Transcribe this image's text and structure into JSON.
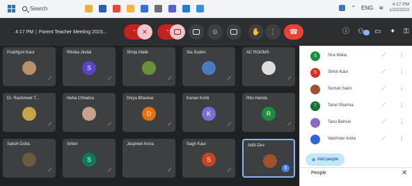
{
  "taskbar": {
    "search_label": "Search",
    "apps": [
      {
        "name": "file-explorer-icon",
        "color": "#e8b13a"
      },
      {
        "name": "word-icon",
        "color": "#2b5fb3"
      },
      {
        "name": "chrome-icon",
        "color": "#e04b3b"
      },
      {
        "name": "folder-icon",
        "color": "#f2b53a"
      },
      {
        "name": "store-icon",
        "color": "#3a6fd3"
      },
      {
        "name": "settings-icon",
        "color": "#6d6d6d"
      },
      {
        "name": "teams-icon",
        "color": "#5b5fc7"
      },
      {
        "name": "mail-icon",
        "color": "#2a79d8"
      },
      {
        "name": "photos-icon",
        "color": "#3f8bd9"
      }
    ],
    "tray": {
      "lang": "ENG",
      "time": "4:17 PM",
      "date": "1/23/2023"
    }
  },
  "meet": {
    "time": "4:17 PM",
    "title": "Parent Teacher Meeting 2023..."
  },
  "tiles": [
    {
      "name": "Prabhjyot Kaur",
      "initial": "",
      "color": "#b7916e"
    },
    {
      "name": "Ritvika Jindal",
      "initial": "S",
      "color": "#5a43c7"
    },
    {
      "name": "Shrija Malik",
      "initial": "",
      "color": "#6b8e3a"
    },
    {
      "name": "Sia Suden",
      "initial": "",
      "color": "#4a7bbf"
    },
    {
      "name": "AC ROOMS",
      "initial": "",
      "color": "#dddddd"
    },
    {
      "name": "Dr. Rashmeet T...",
      "initial": "",
      "color": "#c9a24a"
    },
    {
      "name": "Neha Chhabra",
      "initial": "",
      "color": "#c9a08c"
    },
    {
      "name": "Divya Bhaskar",
      "initial": "D",
      "color": "#e8710a"
    },
    {
      "name": "Kanan Kohli",
      "initial": "K",
      "color": "#7b6fd6"
    },
    {
      "name": "Ritu Handa",
      "initial": "R",
      "color": "#1e8e3e"
    },
    {
      "name": "Saksh Dutta",
      "initial": "",
      "color": "#6b5b3e"
    },
    {
      "name": "Sriten",
      "initial": "S",
      "color": "#0b7b5b"
    },
    {
      "name": "Jaspreet Arora",
      "initial": "",
      "color": "#3c4043"
    },
    {
      "name": "Sagn Kaur",
      "initial": "S",
      "color": "#c5461f"
    },
    {
      "name": "Aditi Dev",
      "initial": "",
      "color": "#a0522d"
    }
  ],
  "panel": {
    "heading": "People",
    "add_people": "Add people",
    "participants": [
      {
        "name": "Sira Walia",
        "initial": "S",
        "color": "#1e8e3e"
      },
      {
        "name": "Simin Kaur",
        "initial": "S",
        "color": "#d93025"
      },
      {
        "name": "Suman Saini",
        "initial": "",
        "color": "#a0522d"
      },
      {
        "name": "Tanvi Sharma",
        "initial": "T",
        "color": "#137333"
      },
      {
        "name": "Tanu Bansal",
        "initial": "",
        "color": "#8a6bbf"
      },
      {
        "name": "Vaishnav Arora",
        "initial": "",
        "color": "#3367d6"
      }
    ]
  }
}
